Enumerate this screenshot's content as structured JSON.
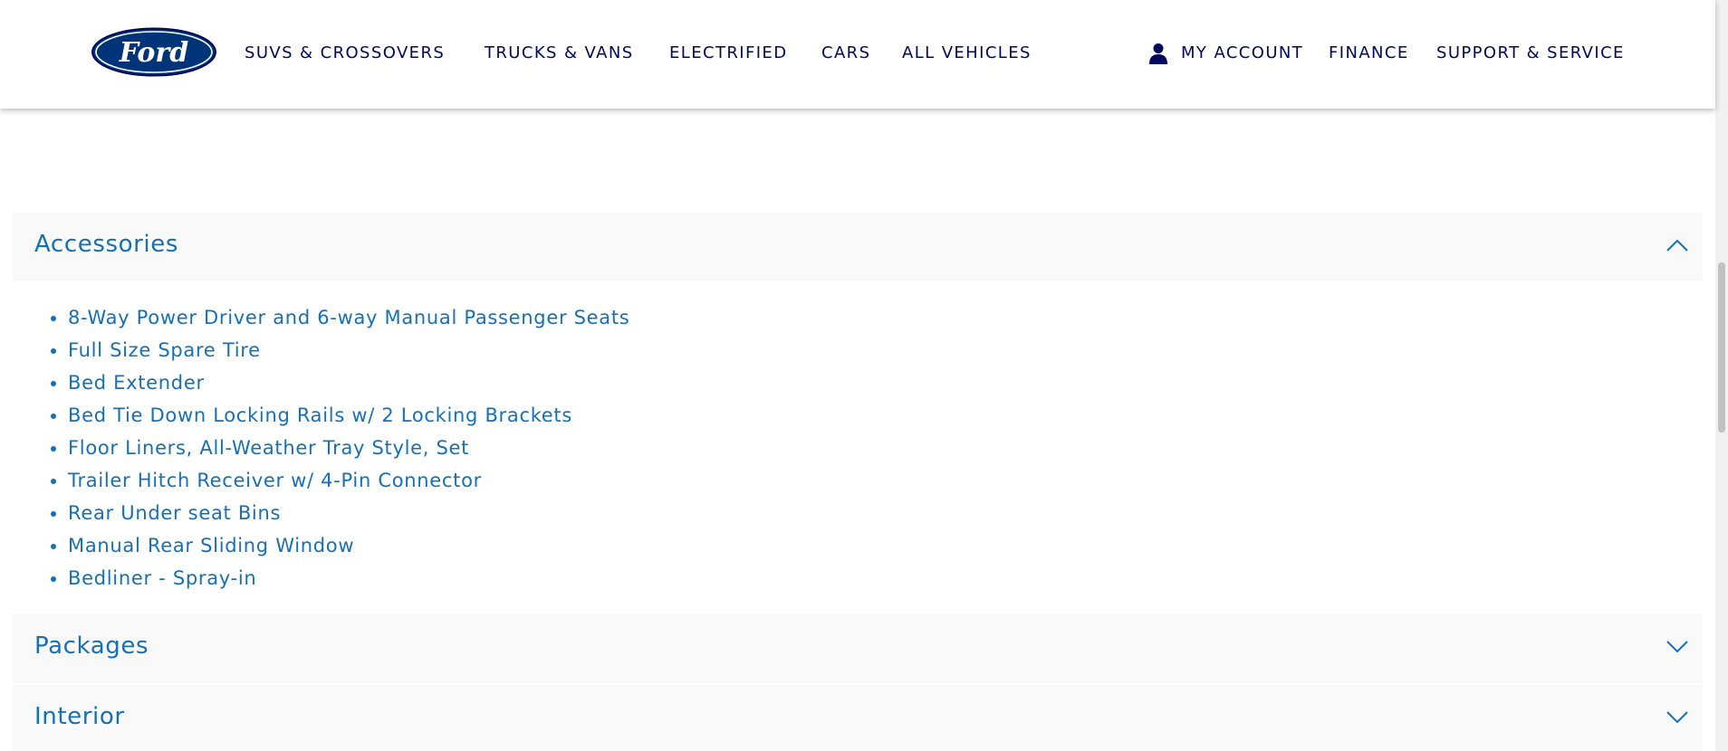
{
  "header": {
    "logo_text": "Ford",
    "nav_left": [
      "SUVS & CROSSOVERS",
      "TRUCKS & VANS",
      "ELECTRIFIED",
      "CARS",
      "ALL VEHICLES"
    ],
    "nav_right": {
      "account_icon": "user-icon",
      "account": "MY ACCOUNT",
      "finance": "FINANCE",
      "support": "SUPPORT & SERVICE"
    }
  },
  "accordion": {
    "accessories": {
      "title": "Accessories",
      "state": "expanded",
      "items": [
        "8-Way Power Driver and 6-way Manual Passenger Seats",
        "Full Size Spare Tire",
        "Bed Extender",
        "Bed Tie Down Locking Rails w/ 2 Locking Brackets",
        "Floor Liners, All-Weather Tray Style, Set",
        "Trailer Hitch Receiver w/ 4-Pin Connector",
        "Rear Under seat Bins",
        "Manual Rear Sliding Window",
        "Bedliner - Spray-in"
      ]
    },
    "packages": {
      "title": "Packages",
      "state": "collapsed"
    },
    "interior": {
      "title": "Interior",
      "state": "collapsed"
    }
  },
  "colors": {
    "brand_navy": "#00095b",
    "link_blue": "#1670b5",
    "panel_bg": "#f9f9f9"
  }
}
